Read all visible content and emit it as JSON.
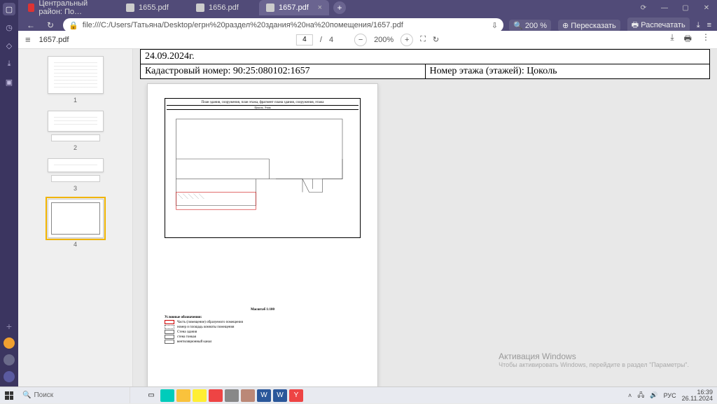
{
  "rail": {
    "plus": "+"
  },
  "tabs": [
    {
      "label": "Центральный район: По…",
      "icon": "red"
    },
    {
      "label": "1655.pdf",
      "icon": "doc"
    },
    {
      "label": "1656.pdf",
      "icon": "doc"
    },
    {
      "label": "1657.pdf",
      "icon": "doc",
      "active": true
    }
  ],
  "newtab": "+",
  "winctrl": {
    "sync": "⟳",
    "min": "—",
    "max": "▢",
    "close": "✕"
  },
  "address": {
    "back": "←",
    "reload": "↻",
    "lock": "🔒",
    "url": "file:///C:/Users/Татьяна/Desktop/егрн%20раздел%20здания%20на%20помещения/1657.pdf",
    "bookmark": "⇩",
    "zoom": "🔍 200 %",
    "retell": "⊕ Пересказать",
    "print": "🖶 Распечатать",
    "dl": "⤓",
    "more": "≡"
  },
  "pdfbar": {
    "menu": "≡",
    "title": "1657.pdf",
    "page_cur": "4",
    "page_sep": "/",
    "page_total": "4",
    "minus": "−",
    "zoom": "200%",
    "plus": "+",
    "fit": "⛶",
    "rotate": "↻",
    "more": "⋮",
    "dl": "⤓",
    "print": "🖶"
  },
  "thumbs": [
    "1",
    "2",
    "3",
    "4"
  ],
  "doc": {
    "date": "24.09.2024г.",
    "cadastral_label": "Кадастровый номер: ",
    "cadastral_value": "90:25:080102:1657",
    "floor_label": "Номер этажа (этажей): ",
    "floor_value": "Цоколь",
    "plan_title": "План здания, сооружения, план этажа, фрагмент плана здания, сооружения, этажа",
    "plan_sub": "Цоколь. Этаж",
    "scale": "Масштаб 1:100",
    "legend_title": "Условные обозначения:",
    "legend": [
      "Часть (помещение) образуемого помещения",
      "номер и площадь комнаты помещения",
      "Стена здания",
      "стена тонкая",
      "вентиляционный канал"
    ]
  },
  "watermark": {
    "title": "Активация Windows",
    "sub": "Чтобы активировать Windows, перейдите в раздел \"Параметры\"."
  },
  "taskbar": {
    "search_icon": "🔍",
    "search": "Поиск",
    "lang": "РУС",
    "time": "16:39",
    "date": "26.11.2024",
    "tray_up": "˄",
    "tray_net": "🖧",
    "tray_vol": "🔊"
  }
}
